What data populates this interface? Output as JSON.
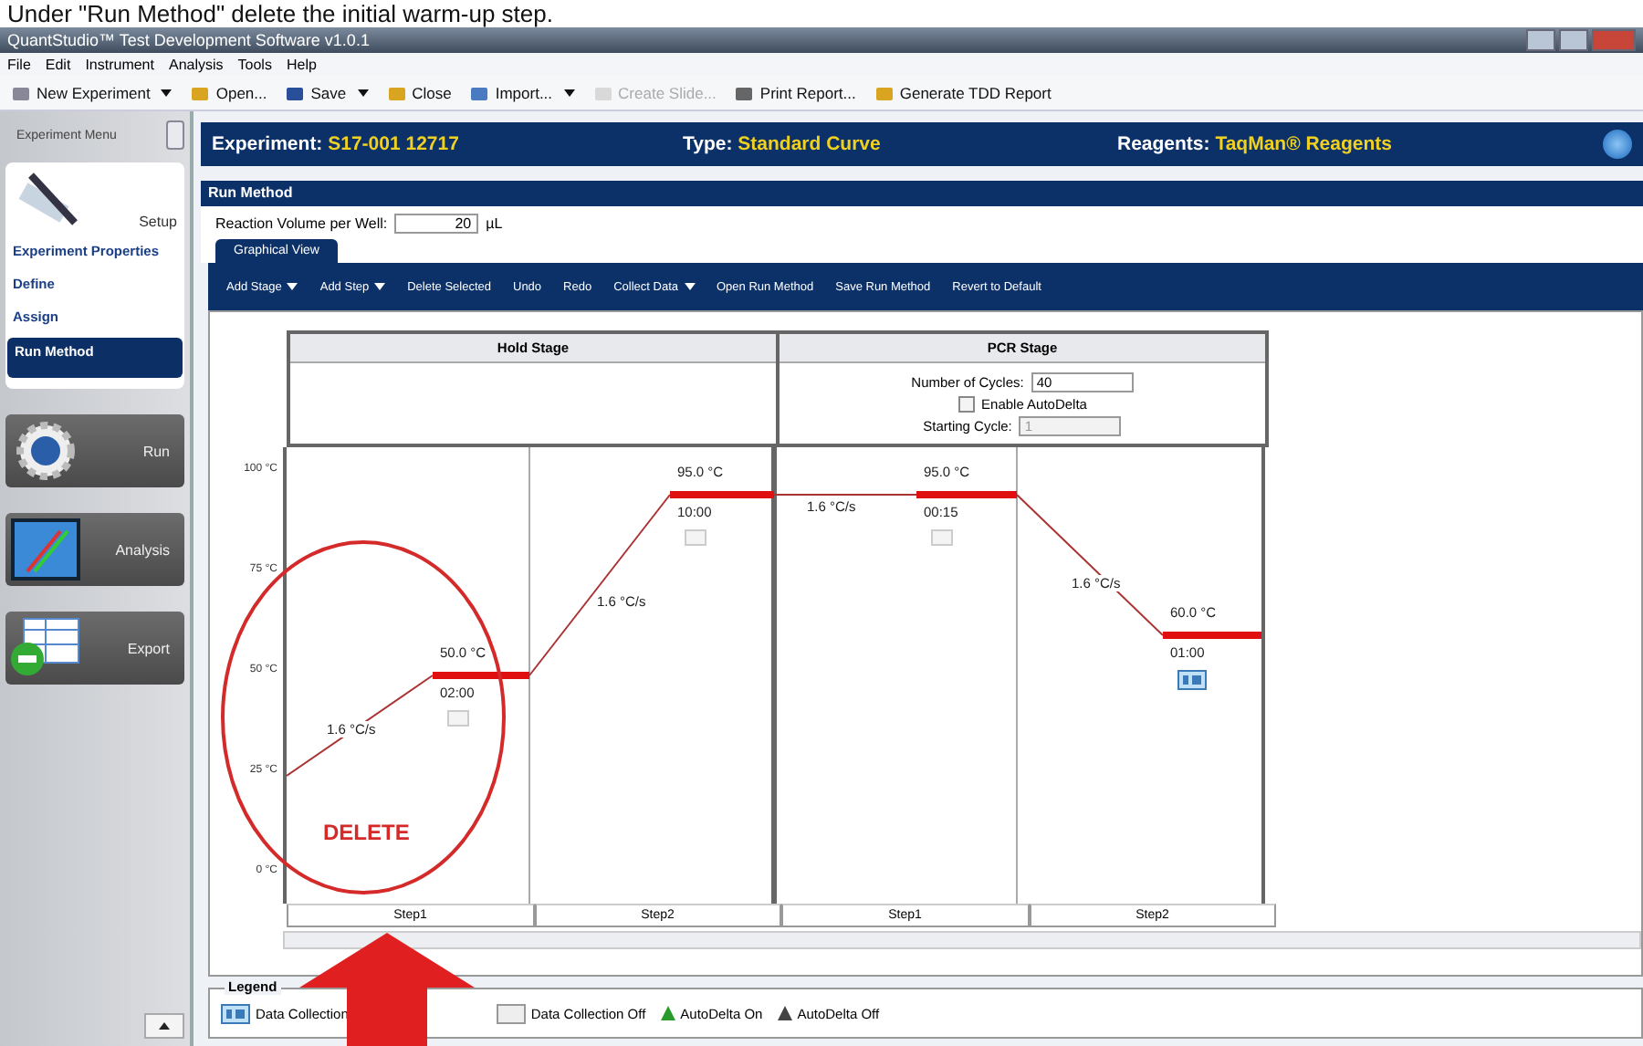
{
  "caption": "Under \"Run Method\" delete the initial warm-up step.",
  "window": {
    "title": "QuantStudio™ Test Development Software v1.0.1"
  },
  "menu": [
    "File",
    "Edit",
    "Instrument",
    "Analysis",
    "Tools",
    "Help"
  ],
  "toolbar": [
    {
      "label": "New Experiment",
      "kind": "new",
      "dropdown": true,
      "disabled": false
    },
    {
      "label": "Open...",
      "kind": "open",
      "dropdown": false,
      "disabled": false
    },
    {
      "label": "Save",
      "kind": "save",
      "dropdown": true,
      "disabled": false
    },
    {
      "label": "Close",
      "kind": "close",
      "dropdown": false,
      "disabled": false
    },
    {
      "label": "Import...",
      "kind": "import",
      "dropdown": true,
      "disabled": false
    },
    {
      "label": "Create Slide...",
      "kind": "slide",
      "dropdown": false,
      "disabled": true
    },
    {
      "label": "Print Report...",
      "kind": "print",
      "dropdown": false,
      "disabled": false
    },
    {
      "label": "Generate TDD Report",
      "kind": "report",
      "dropdown": false,
      "disabled": false
    }
  ],
  "sidebar": {
    "header": "Experiment Menu",
    "setup": {
      "label": "Setup",
      "items": [
        {
          "label": "Experiment Properties",
          "selected": false
        },
        {
          "label": "Define",
          "selected": false
        },
        {
          "label": "Assign",
          "selected": false
        },
        {
          "label": "Run Method",
          "selected": true
        }
      ]
    },
    "sections": [
      {
        "label": "Run",
        "kind": "run"
      },
      {
        "label": "Analysis",
        "kind": "analysis"
      },
      {
        "label": "Export",
        "kind": "export"
      }
    ]
  },
  "header": {
    "experiment_label": "Experiment:",
    "experiment": "S17-001 12717",
    "type_label": "Type:",
    "type": "Standard Curve",
    "reagents_label": "Reagents:",
    "reagents": "TaqMan® Reagents"
  },
  "panel_title": "Run Method",
  "reaction_volume": {
    "label": "Reaction Volume per Well:",
    "value": "20",
    "unit": "µL"
  },
  "tabs": [
    {
      "label": "Graphical View",
      "selected": true
    }
  ],
  "method_toolbar": [
    {
      "label": "Add Stage",
      "dropdown": true
    },
    {
      "label": "Add Step",
      "dropdown": true
    },
    {
      "label": "Delete Selected",
      "dropdown": false
    },
    {
      "label": "Undo",
      "dropdown": false
    },
    {
      "label": "Redo",
      "dropdown": false
    },
    {
      "label": "Collect Data",
      "dropdown": true
    },
    {
      "label": "Open Run Method",
      "dropdown": false
    },
    {
      "label": "Save Run Method",
      "dropdown": false
    },
    {
      "label": "Revert to Default",
      "dropdown": false
    }
  ],
  "y_axis": [
    "100 °C",
    "75 °C",
    "50 °C",
    "25 °C",
    "0 °C"
  ],
  "stages": [
    {
      "title": "Hold Stage",
      "kind": "hold",
      "steps": [
        {
          "label": "Step1",
          "temp": "50.0 °C",
          "time": "02:00",
          "ramp": "1.6 °C/s",
          "data_collection": false
        },
        {
          "label": "Step2",
          "temp": "95.0 °C",
          "time": "10:00",
          "ramp": "1.6 °C/s",
          "data_collection": false
        }
      ]
    },
    {
      "title": "PCR Stage",
      "kind": "pcr",
      "cycles_label": "Number of Cycles:",
      "cycles": "40",
      "autodelta_label": "Enable AutoDelta",
      "autodelta": false,
      "starting_cycle_label": "Starting Cycle:",
      "starting_cycle": "1",
      "steps": [
        {
          "label": "Step1",
          "temp": "95.0 °C",
          "time": "00:15",
          "ramp": "1.6 °C/s",
          "data_collection": false
        },
        {
          "label": "Step2",
          "temp": "60.0 °C",
          "time": "01:00",
          "ramp": "1.6 °C/s",
          "data_collection": true
        }
      ]
    }
  ],
  "annotation": {
    "label": "DELETE"
  },
  "legend": {
    "title": "Legend",
    "items": [
      {
        "label": "Data Collection",
        "kind": "collect_on"
      },
      {
        "label": "Data Collection Off",
        "kind": "collect_off"
      },
      {
        "label": "AutoDelta On",
        "kind": "autodelta_on"
      },
      {
        "label": "AutoDelta Off",
        "kind": "autodelta_off"
      }
    ]
  }
}
